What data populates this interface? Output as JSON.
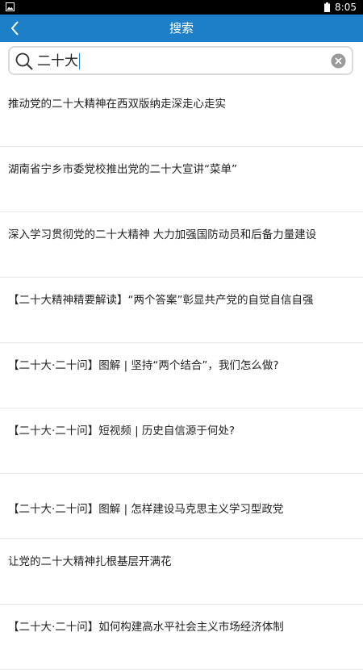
{
  "status_bar": {
    "time": "8:05",
    "left_icon": "image-icon",
    "right_icon": "battery-icon"
  },
  "app_bar": {
    "title": "搜索",
    "back_icon": "back-chevron-icon",
    "background": "#1e7fc9"
  },
  "search": {
    "value": "二十大",
    "icon": "search-icon",
    "clear_icon": "clear-icon"
  },
  "results": [
    {
      "title": "推动党的二十大精神在西双版纳走深走心走实"
    },
    {
      "title": "湖南省宁乡市委党校推出党的二十大宣讲“菜单”"
    },
    {
      "title": "深入学习贯彻党的二十大精神 大力加强国防动员和后备力量建设"
    },
    {
      "title": "【二十大精神精要解读】“两个答案”彰显共产党的自觉自信自强"
    },
    {
      "title": "【二十大·二十问】图解 | 坚持“两个结合”，我们怎么做?"
    },
    {
      "title": "【二十大·二十问】短视频 | 历史自信源于何处?"
    },
    {
      "title": "【二十大·二十问】图解 | 怎样建设马克思主义学习型政党"
    },
    {
      "title": "让党的二十大精神扎根基层开满花"
    },
    {
      "title": "【二十大·二十问】如何构建高水平社会主义市场经济体制"
    }
  ]
}
